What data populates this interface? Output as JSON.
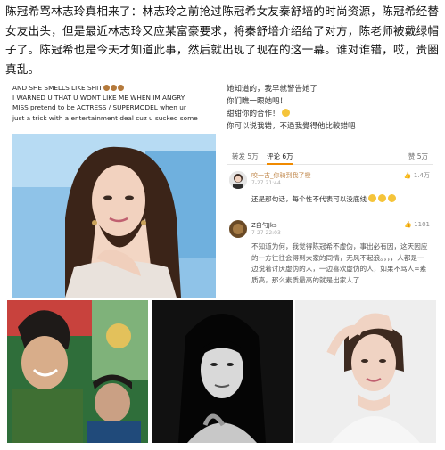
{
  "headline": "陈冠希骂林志玲真相来了：林志玲之前抢过陈冠希女友秦舒培的时尚资源，陈冠希经替女友出头，但是最近林志玲又应某富豪要求，将秦舒培介绍给了对方，陈老师被戴绿帽子了。陈冠希也是今天才知道此事，然后就出现了现在的这一幕。谁对谁错，哎，贵圈真乱。",
  "quote": {
    "lines": [
      "AND SHE SMELLS LIKE SHIT",
      "I WARNED U THAT U WONT LIKE ME WHEN IM ANGRY",
      "MISS pretend to be ACTRESS / SUPERMODEL when ur",
      "just a trick with a entertainment deal cuz u sucked some"
    ]
  },
  "post": {
    "lines": [
      "她知道的，我早就警告她了",
      "你们瞧一眼她吧！",
      "甜甜你的合作！",
      "你可以说我错，不過我覺得他比較錯吧"
    ]
  },
  "tabs": {
    "repost": "转发 5万",
    "comment": "评论 6万",
    "like": "赞 5万"
  },
  "comments": [
    {
      "name": "咬一古_你骑到我了橙",
      "time": "7-27 21:44",
      "likes": "1.4万",
      "text": "还是那句话，每个性不代表可以没底线"
    },
    {
      "name": "Z自勺Jks",
      "time": "7-27 22:03",
      "likes": "1101",
      "text": "不知道为何，我觉得陈冠希不虚伪，事出必有因，这天因应的一方往往会得到大家的同情，无风不起浪。，，，人都是一边说着讨厌虚伪的人，一边喜欢虚伪的人，如果不骂人=素质高，那么素质最高的就是出家人了"
    }
  ]
}
